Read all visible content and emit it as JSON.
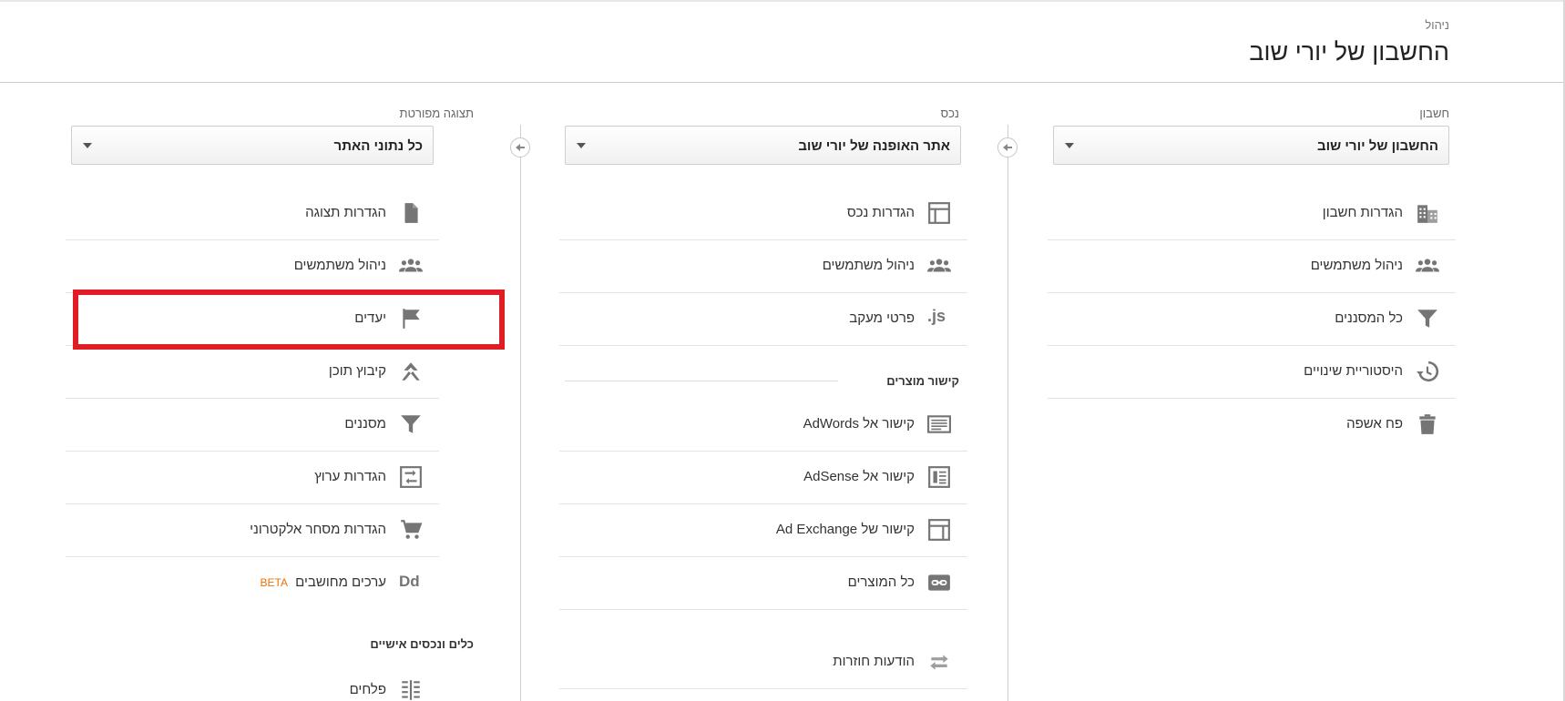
{
  "header": {
    "breadcrumb": "ניהול",
    "title": "החשבון של יורי שוב"
  },
  "columns": {
    "account": {
      "label": "חשבון",
      "selected": "החשבון של יורי שוב",
      "items": [
        {
          "label": "הגדרות חשבון",
          "icon": "building-icon"
        },
        {
          "label": "ניהול משתמשים",
          "icon": "users-icon"
        },
        {
          "label": "כל המסננים",
          "icon": "filter-icon"
        },
        {
          "label": "היסטוריית שינויים",
          "icon": "history-icon"
        },
        {
          "label": "פח אשפה",
          "icon": "trash-icon"
        }
      ]
    },
    "property": {
      "label": "נכס",
      "selected": "אתר האופנה של יורי שוב",
      "items": [
        {
          "label": "הגדרות נכס",
          "icon": "window-icon"
        },
        {
          "label": "ניהול משתמשים",
          "icon": "users-icon"
        },
        {
          "label": "פרטי מעקב",
          "icon": "js-icon",
          "icon_text": ".js"
        }
      ],
      "section_title": "קישור מוצרים",
      "product_links": [
        {
          "label": "קישור אל AdWords",
          "icon": "adwords-icon"
        },
        {
          "label": "קישור אל AdSense",
          "icon": "adsense-icon"
        },
        {
          "label": "קישור של Ad Exchange",
          "icon": "ad-exchange-icon"
        },
        {
          "label": "כל המוצרים",
          "icon": "link-icon"
        }
      ],
      "extra_item": {
        "label": "הודעות חוזרות",
        "icon": "remarketing-icon"
      }
    },
    "view": {
      "label": "תצוגה מפורטת",
      "selected": "כל נתוני האתר",
      "items": [
        {
          "label": "הגדרות תצוגה",
          "icon": "document-icon"
        },
        {
          "label": "ניהול משתמשים",
          "icon": "users-icon"
        },
        {
          "label": "יעדים",
          "icon": "flag-icon"
        },
        {
          "label": "קיבוץ תוכן",
          "icon": "content-grouping-icon"
        },
        {
          "label": "מסננים",
          "icon": "filter-icon"
        },
        {
          "label": "הגדרות ערוץ",
          "icon": "channel-settings-icon"
        },
        {
          "label": "הגדרות מסחר אלקטרוני",
          "icon": "cart-icon"
        },
        {
          "label": "ערכים מחושבים",
          "icon": "calculated-icon",
          "icon_text": "Dd",
          "badge": "BETA"
        }
      ],
      "section_title": "כלים ונכסים אישיים",
      "extra_item": {
        "label": "פלחים",
        "icon": "segments-icon"
      }
    }
  },
  "colors": {
    "highlight": "#e01c24",
    "beta": "#e8710a",
    "icon": "#757575"
  }
}
